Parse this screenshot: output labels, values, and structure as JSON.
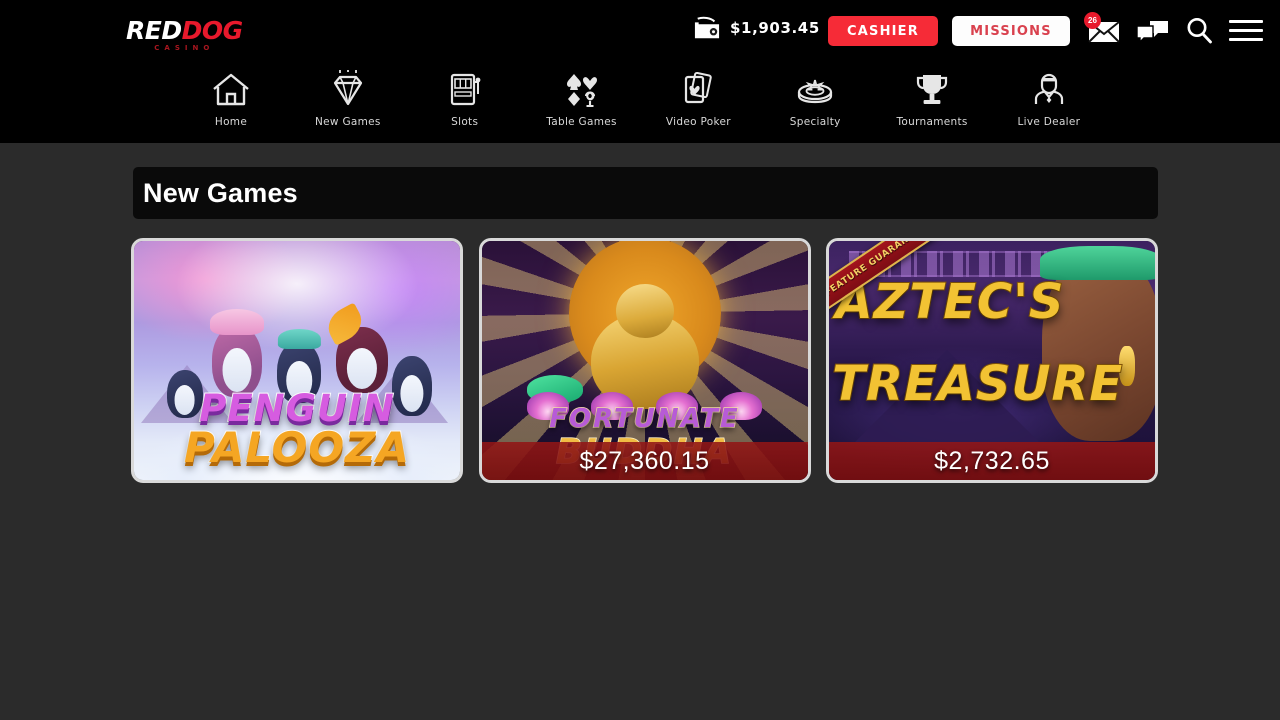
{
  "brand": {
    "logo_primary": "RED",
    "logo_secondary": "DOG",
    "logo_subtitle": "CASINO",
    "accent_red": "#e8192c",
    "cashier_red": "#f62b37",
    "page_bg": "#2b2b2b",
    "header_bg": "#000000"
  },
  "header": {
    "balance": "$1,903.45",
    "wallet_icon": "wallet-icon",
    "cashier_label": "CASHIER",
    "missions_label": "MISSIONS",
    "mail_badge": "26",
    "mail_icon": "envelope-icon",
    "chat_icon": "chat-bubbles-icon",
    "search_icon": "search-icon",
    "menu_icon": "hamburger-menu-icon"
  },
  "nav": {
    "items": [
      {
        "label": "Home",
        "icon": "house-icon"
      },
      {
        "label": "New Games",
        "icon": "diamond-gem-icon"
      },
      {
        "label": "Slots",
        "icon": "slot-machine-icon"
      },
      {
        "label": "Table Games",
        "icon": "card-suits-icon"
      },
      {
        "label": "Video Poker",
        "icon": "playing-cards-icon"
      },
      {
        "label": "Specialty",
        "icon": "roulette-wheel-icon"
      },
      {
        "label": "Tournaments",
        "icon": "trophy-icon"
      },
      {
        "label": "Live Dealer",
        "icon": "dealer-person-icon"
      }
    ]
  },
  "main": {
    "section_title": "New Games",
    "games": [
      {
        "name": "Penguin Palooza",
        "title_line1": "PENGUIN",
        "title_line2": "PALOOZA",
        "jackpot": "",
        "ribbon": ""
      },
      {
        "name": "Fortunate Buddha",
        "title_line1": "FORTUNATE",
        "title_line2": "BUDDHA",
        "jackpot": "$27,360.15",
        "ribbon": ""
      },
      {
        "name": "Aztec's Treasure",
        "title_line1": "AZTEC'S",
        "title_line2": "TREASURE",
        "jackpot": "$2,732.65",
        "ribbon": "WIN FEATURE GUARANTEE"
      }
    ]
  }
}
